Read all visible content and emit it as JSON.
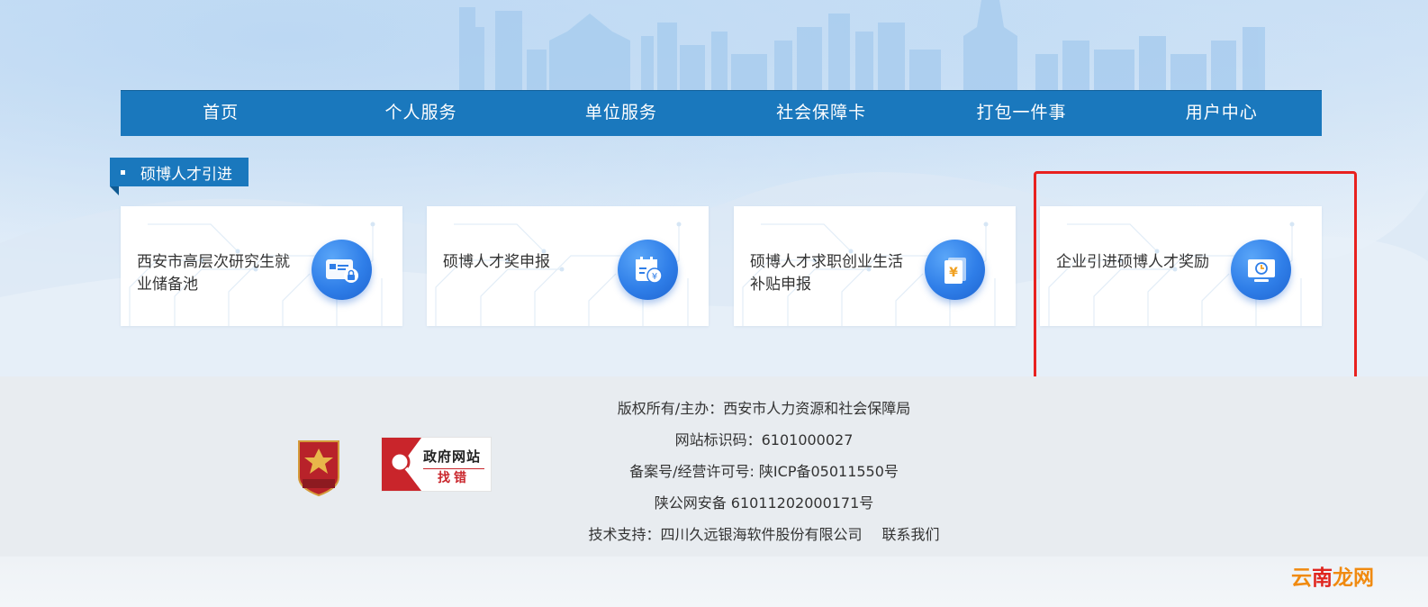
{
  "nav": {
    "items": [
      "首页",
      "个人服务",
      "单位服务",
      "社会保障卡",
      "打包一件事",
      "用户中心"
    ]
  },
  "section": {
    "title": "硕博人才引进"
  },
  "cards": [
    {
      "title": "西安市高层次研究生就业储备池",
      "icon": "id-card-lock-icon"
    },
    {
      "title": "硕博人才奖申报",
      "icon": "calendar-yuan-icon"
    },
    {
      "title": "硕博人才求职创业生活补贴申报",
      "icon": "document-yuan-icon"
    },
    {
      "title": "企业引进硕博人才奖励",
      "icon": "monitor-clock-icon"
    }
  ],
  "highlight": {
    "color": "#e8211f",
    "target": "企业引进硕博人才奖励"
  },
  "footer": {
    "copyright": "版权所有/主办：西安市人力资源和社会保障局",
    "site_code": "网站标识码：6101000027",
    "icp": "备案号/经营许可号: 陕ICP备05011550号",
    "police": "陕公网安备 61011202000171号",
    "tech_support": "技术支持：四川久远银海软件股份有限公司",
    "contact": "联系我们",
    "party_badge_text": "党政机关",
    "gov_badge": {
      "title": "政府网站",
      "subtitle": "找错"
    }
  },
  "watermark": {
    "part1": "云",
    "part2": "南",
    "part3": "龙网"
  },
  "colors": {
    "nav_bg": "#1a78bd",
    "icon_blue": "#2f7ee8",
    "footer_bg": "#e8ecf0",
    "text": "#333333"
  }
}
